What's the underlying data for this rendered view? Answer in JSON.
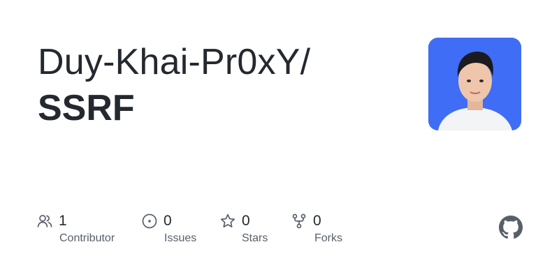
{
  "repo": {
    "owner_text": "Duy-Khai-Pr0xY/",
    "name": "SSRF"
  },
  "avatar": {
    "alt": "user avatar",
    "background": "#3f6df6"
  },
  "stats": [
    {
      "icon": "people-icon",
      "count": "1",
      "label": "Contributor"
    },
    {
      "icon": "issue-icon",
      "count": "0",
      "label": "Issues"
    },
    {
      "icon": "star-icon",
      "count": "0",
      "label": "Stars"
    },
    {
      "icon": "fork-icon",
      "count": "0",
      "label": "Forks"
    }
  ],
  "brand": {
    "logo": "github-logo-icon",
    "color": "#57606a"
  }
}
